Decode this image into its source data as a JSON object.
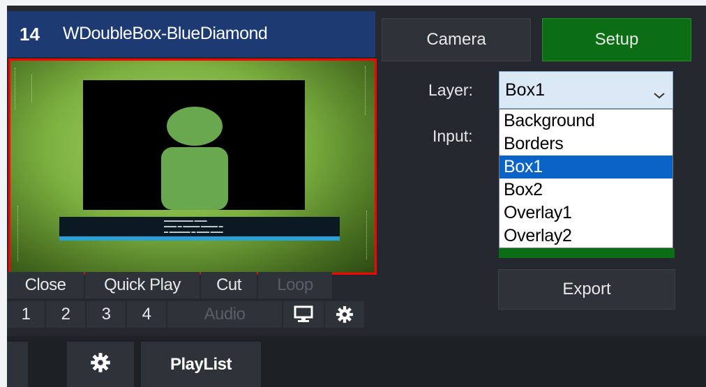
{
  "input": {
    "number": "14",
    "title": "WDoubleBox-BlueDiamond"
  },
  "preview": {
    "lower_third_lines": [
      "▬▬▬▬▬▬▬ ▬▬▬",
      "▬▬▬ ▬ ▬▬▬▬ ▬▬▬▬ ▬",
      "▬ ▬▬▬▬▬ ▬ ▬▬▬ ▬▬▬"
    ]
  },
  "controls": {
    "row1": [
      "Close",
      "Quick Play",
      "Cut",
      "Loop"
    ],
    "row2": [
      "1",
      "2",
      "3",
      "4",
      "Audio"
    ]
  },
  "tabs": {
    "camera": "Camera",
    "setup": "Setup"
  },
  "layer": {
    "label": "Layer:",
    "selected": "Box1",
    "options": [
      "Background",
      "Borders",
      "Box1",
      "Box2",
      "Overlay1",
      "Overlay2"
    ]
  },
  "input_field": {
    "label": "Input:"
  },
  "export_label": "Export",
  "bottom": {
    "playlist_label": "PlayList"
  },
  "icons": {
    "monitor": "monitor-icon",
    "settings": "gear-icon",
    "dropdown": "chevron-down-icon"
  },
  "colors": {
    "setup_green": "#0b6e14",
    "selection_blue": "#0a64c8",
    "preview_border": "#ff0000",
    "header_blue": "#1d3a73"
  }
}
